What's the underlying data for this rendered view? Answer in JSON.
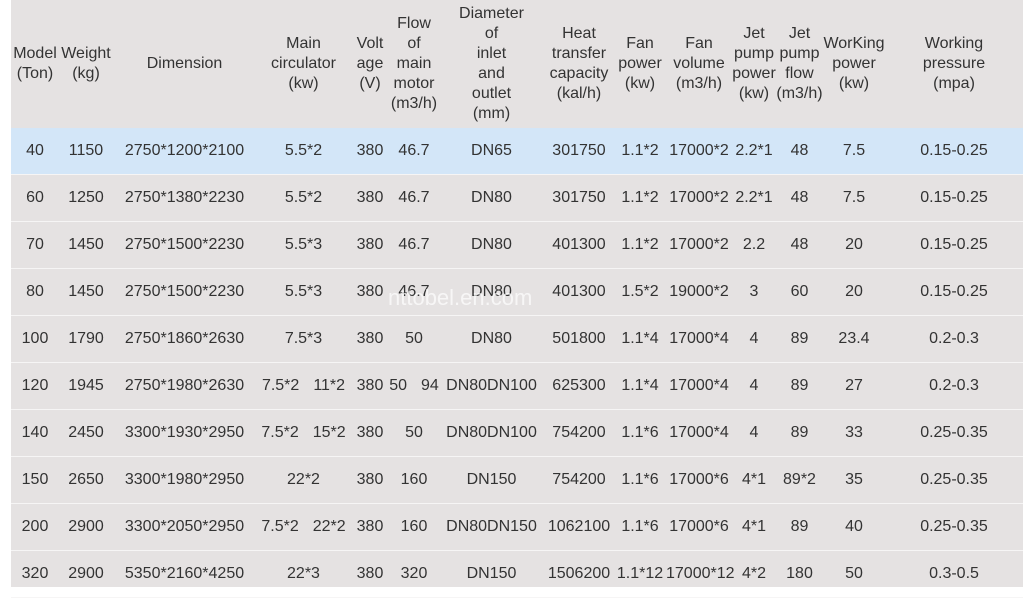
{
  "headers": [
    "Model\n(Ton)",
    "Weight\n(kg)",
    "Dimension",
    "Main\ncirculator\n(kw)",
    "Volt\nage\n(V)",
    "Flow\nof\nmain\nmotor\n(m3/h)",
    "Diameter\nof\ninlet\nand\noutlet\n(mm)",
    "Heat\ntransfer\ncapacity\n(kal/h)",
    "Fan\npower\n(kw)",
    "Fan\nvolume\n(m3/h)",
    "Jet\npump\npower\n(kw)",
    "Jet\npump\nflow\n(m3/h)",
    "WorKing\npower\n(kw)",
    "Working\npressure\n(mpa)"
  ],
  "rows": [
    {
      "model": "40",
      "weight": "1150",
      "dimension": "2750*1200*2100",
      "circulator": [
        "5.5*2"
      ],
      "voltage": "380",
      "flow": [
        "46.7"
      ],
      "diameter": [
        "DN65"
      ],
      "heat": "301750",
      "fan_power": "1.1*2",
      "fan_volume": "17000*2",
      "jet_power": "2.2*1",
      "jet_flow": "48",
      "working_power": "7.5",
      "pressure": "0.15-0.25"
    },
    {
      "model": "60",
      "weight": "1250",
      "dimension": "2750*1380*2230",
      "circulator": [
        "5.5*2"
      ],
      "voltage": "380",
      "flow": [
        "46.7"
      ],
      "diameter": [
        "DN80"
      ],
      "heat": "301750",
      "fan_power": "1.1*2",
      "fan_volume": "17000*2",
      "jet_power": "2.2*1",
      "jet_flow": "48",
      "working_power": "7.5",
      "pressure": "0.15-0.25"
    },
    {
      "model": "70",
      "weight": "1450",
      "dimension": "2750*1500*2230",
      "circulator": [
        "5.5*3"
      ],
      "voltage": "380",
      "flow": [
        "46.7"
      ],
      "diameter": [
        "DN80"
      ],
      "heat": "401300",
      "fan_power": "1.1*2",
      "fan_volume": "17000*2",
      "jet_power": "2.2",
      "jet_flow": "48",
      "working_power": "20",
      "pressure": "0.15-0.25"
    },
    {
      "model": "80",
      "weight": "1450",
      "dimension": "2750*1500*2230",
      "circulator": [
        "5.5*3"
      ],
      "voltage": "380",
      "flow": [
        "46.7"
      ],
      "diameter": [
        "DN80"
      ],
      "heat": "401300",
      "fan_power": "1.5*2",
      "fan_volume": "19000*2",
      "jet_power": "3",
      "jet_flow": "60",
      "working_power": "20",
      "pressure": "0.15-0.25"
    },
    {
      "model": "100",
      "weight": "1790",
      "dimension": "2750*1860*2630",
      "circulator": [
        "7.5*3"
      ],
      "voltage": "380",
      "flow": [
        "50"
      ],
      "diameter": [
        "DN80"
      ],
      "heat": "501800",
      "fan_power": "1.1*4",
      "fan_volume": "17000*4",
      "jet_power": "4",
      "jet_flow": "89",
      "working_power": "23.4",
      "pressure": "0.2-0.3"
    },
    {
      "model": "120",
      "weight": "1945",
      "dimension": "2750*1980*2630",
      "circulator": [
        "7.5*2",
        "11*2"
      ],
      "voltage": "380",
      "flow": [
        "50",
        "94"
      ],
      "diameter": [
        "DN80",
        "DN100"
      ],
      "heat": "625300",
      "fan_power": "1.1*4",
      "fan_volume": "17000*4",
      "jet_power": "4",
      "jet_flow": "89",
      "working_power": "27",
      "pressure": "0.2-0.3"
    },
    {
      "model": "140",
      "weight": "2450",
      "dimension": "3300*1930*2950",
      "circulator": [
        "7.5*2",
        "15*2"
      ],
      "voltage": "380",
      "flow": [
        "50"
      ],
      "diameter": [
        "DN80",
        "DN100"
      ],
      "heat": "754200",
      "fan_power": "1.1*6",
      "fan_volume": "17000*4",
      "jet_power": "4",
      "jet_flow": "89",
      "working_power": "33",
      "pressure": "0.25-0.35"
    },
    {
      "model": "150",
      "weight": "2650",
      "dimension": "3300*1980*2950",
      "circulator": [
        "22*2"
      ],
      "voltage": "380",
      "flow": [
        "160"
      ],
      "diameter": [
        "DN150"
      ],
      "heat": "754200",
      "fan_power": "1.1*6",
      "fan_volume": "17000*6",
      "jet_power": "4*1",
      "jet_flow": "89*2",
      "working_power": "35",
      "pressure": "0.25-0.35"
    },
    {
      "model": "200",
      "weight": "2900",
      "dimension": "3300*2050*2950",
      "circulator": [
        "7.5*2",
        "22*2"
      ],
      "voltage": "380",
      "flow": [
        "160"
      ],
      "diameter": [
        "DN80",
        "DN150"
      ],
      "heat": "1062100",
      "fan_power": "1.1*6",
      "fan_volume": "17000*6",
      "jet_power": "4*1",
      "jet_flow": "89",
      "working_power": "40",
      "pressure": "0.25-0.35"
    },
    {
      "model": "320",
      "weight": "2900",
      "dimension": "5350*2160*4250",
      "circulator": [
        "22*3"
      ],
      "voltage": "380",
      "flow": [
        "320"
      ],
      "diameter": [
        "DN150"
      ],
      "heat": "1506200",
      "fan_power": "1.1*12",
      "fan_volume": "17000*12",
      "jet_power": "4*2",
      "jet_flow": "180",
      "working_power": "50",
      "pressure": "0.3-0.5"
    }
  ],
  "highlight_row": 0,
  "watermark": "nttobel.en.com",
  "colors": {
    "background": "#e5e2e2",
    "highlight": "#d3e6f8",
    "text": "#333333"
  }
}
